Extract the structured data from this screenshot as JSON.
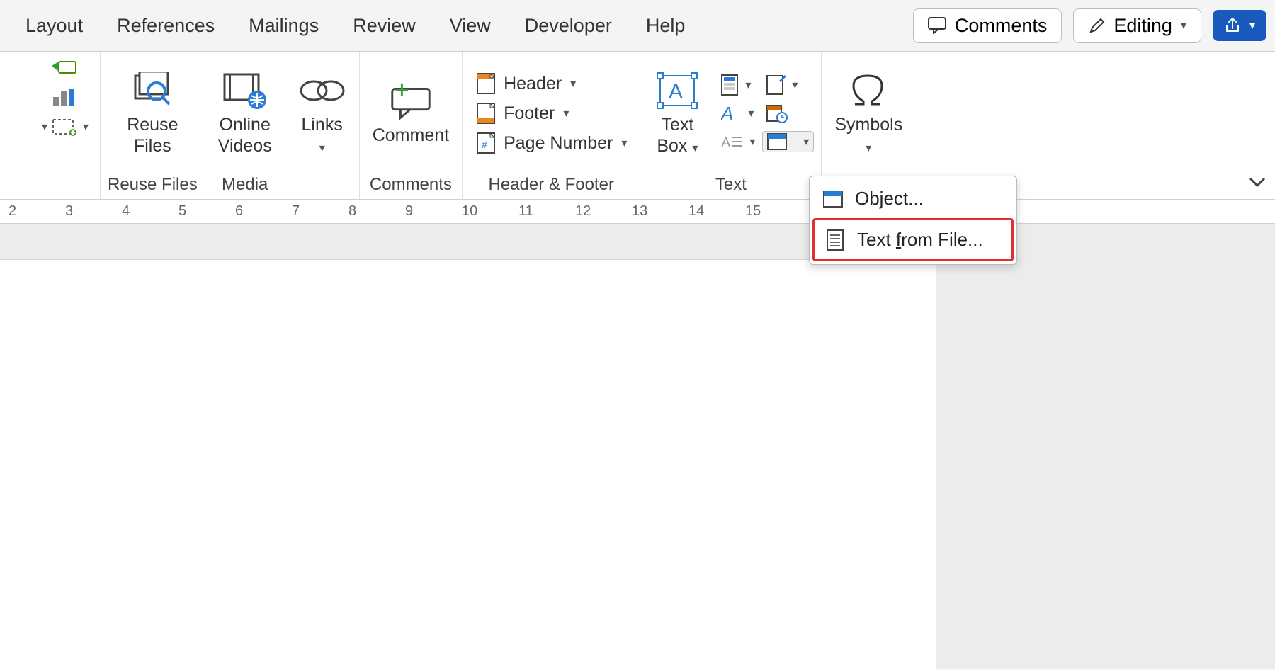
{
  "tabs": {
    "layout": "Layout",
    "references": "References",
    "mailings": "Mailings",
    "review": "Review",
    "view": "View",
    "developer": "Developer",
    "help": "Help"
  },
  "topright": {
    "comments": "Comments",
    "editing": "Editing"
  },
  "ribbon": {
    "reuse_files": {
      "line1": "Reuse",
      "line2": "Files",
      "group": "Reuse Files"
    },
    "media": {
      "line1": "Online",
      "line2": "Videos",
      "group": "Media"
    },
    "links": {
      "label": "Links"
    },
    "comments": {
      "label": "Comment",
      "group": "Comments"
    },
    "header_footer": {
      "header": "Header",
      "footer": "Footer",
      "page_number": "Page Number",
      "group": "Header & Footer"
    },
    "text": {
      "textbox_line1": "Text",
      "textbox_line2": "Box",
      "group": "Text"
    },
    "symbols": {
      "label": "Symbols"
    }
  },
  "dropdown": {
    "object": "Object...",
    "text_from_file_prefix": "Text ",
    "text_from_file_underlined": "f",
    "text_from_file_suffix": "rom File..."
  },
  "ruler": [
    "2",
    "3",
    "4",
    "5",
    "6",
    "7",
    "8",
    "9",
    "10",
    "11",
    "12",
    "13",
    "14",
    "15"
  ]
}
